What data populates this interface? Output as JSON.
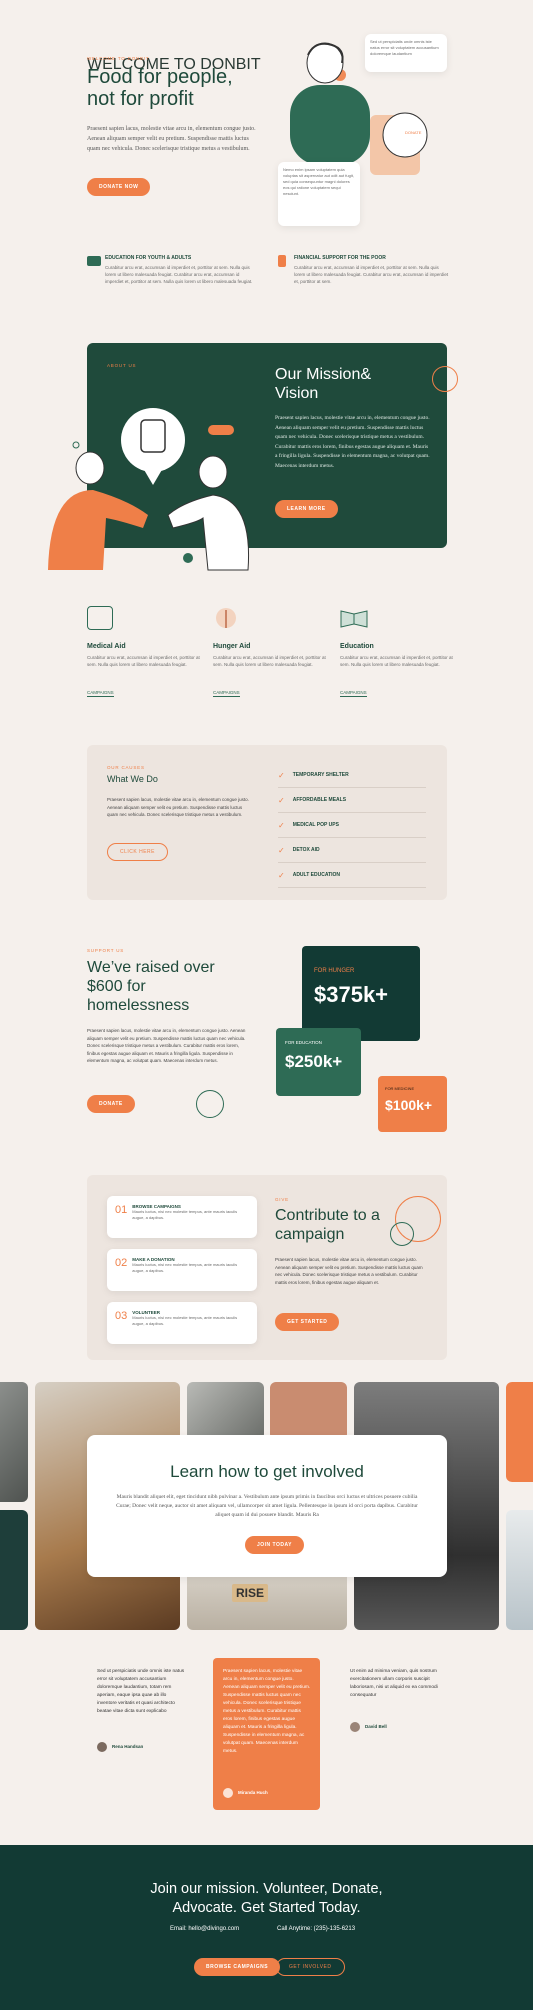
{
  "hero": {
    "eyebrow": "WELCOME TO DONBIT",
    "title": "Food for people, not for profit",
    "body": "Praesent sapien lacus, molestie vitae arcu in, elementum congue justo. Aenean aliquam semper velit eu pretium. Suspendisse mattis luctus quam nec vehicula. Donec scelerisque tristique metus a vestibulum.",
    "button": "DONATE NOW",
    "bubble1": "Sed ut perspiciatis unde omnis iste natus error sit voluptatem accusantium doloremque laudantium",
    "bubble2": "Nemo enim ipsam voluptatem quia voluptas sit aspernatur aut odit aut fugit, sed quia consequuntur magni dolores eos qui ratione voluptatem sequi nesciunt.",
    "donate_badge": "DONATE"
  },
  "features": [
    {
      "title": "EDUCATION FOR YOUTH & ADULTS",
      "body": "Curabitur arcu erat, accumsan id imperdiet et, porttitor at sem. Nulla quis lorem ut libero malesuada feugiat. Curabitur arcu erat, accumsan id imperdiet et, porttitor at sem. Nulla quis lorem ut libero malesuada feugiat."
    },
    {
      "title": "FINANCIAL SUPPORT FOR THE POOR",
      "body": "Curabitur arcu erat, accumsan id imperdiet et, porttitor at sem. Nulla quis lorem ut libero malesuada feugiat. Curabitur arcu erat, accumsan id imperdiet et, porttitor at sem."
    }
  ],
  "mission": {
    "eyebrow": "ABOUT US",
    "title": "Our Mission& Vision",
    "body": "Praesent sapien lacus, molestie vitae arcu in, elementum congue justo. Aenean aliquam semper velit eu pretium. Suspendisse mattis luctus quam nec vehicula. Donec scelerisque tristique metus a vestibulum. Curabitur mattis eros lorem, finibus egestas augue aliquam et. Mauris a fringilla ligula. Suspendisse in elementum magna, ac volutpat quam. Maecenas interdum metus.",
    "button": "LEARN MORE"
  },
  "programs": [
    {
      "title": "Medical Aid",
      "body": "Curabitur arcu erat, accumsan id imperdiet et, porttitor at sem. Nulla quis lorem ut libero malesuada feugiat.",
      "link": "CAMPAIGNS"
    },
    {
      "title": "Hunger Aid",
      "body": "Curabitur arcu erat, accumsan id imperdiet et, porttitor at sem. Nulla quis lorem ut libero malesuada feugiat.",
      "link": "CAMPAIGNS"
    },
    {
      "title": "Education",
      "body": "Curabitur arcu erat, accumsan id imperdiet et, porttitor at sem. Nulla quis lorem ut libero malesuada feugiat.",
      "link": "CAMPAIGNS"
    }
  ],
  "causes": {
    "eyebrow": "OUR CAUSES",
    "title": "What We Do",
    "body": "Praesent sapien lacus, molestie vitae arcu in, elementum congue justo. Aenean aliquam semper velit eu pretium. Suspendisse mattis luctus quam nec vehicula. Donec scelerisque tristique metus a vestibulum.",
    "button": "CLICK HERE",
    "items": [
      "TEMPORARY SHELTER",
      "AFFORDABLE MEALS",
      "MEDICAL POP UPS",
      "DETOX AID",
      "ADULT EDUCATION"
    ]
  },
  "raised": {
    "eyebrow": "SUPPORT US",
    "title": "We’ve raised over $600 for homelessness",
    "body": "Praesent sapien lacus, molestie vitae arcu in, elementum congue justo. Aenean aliquam semper velit eu pretium. Suspendisse mattis luctus quam nec vehicula. Donec scelerisque tristique metus a vestibulum. Curabitur mattis eros lorem, finibus egestas augue aliquam et. Mauris a fringilla ligula. Suspendisse in elementum magna, ac volutpat quam. Maecenas interdum metus.",
    "button": "DONATE",
    "stats": [
      {
        "label": "FOR HUNGER",
        "value": "$375k+"
      },
      {
        "label": "FOR EDUCATION",
        "value": "$250k+"
      },
      {
        "label": "FOR MEDICINE",
        "value": "$100k+"
      }
    ]
  },
  "contribute": {
    "eyebrow": "GIVE",
    "title": "Contribute to a campaign",
    "body": "Praesent sapien lacus, molestie vitae arcu in, elementum congue justo. Aenean aliquam semper velit eu pretium. Suspendisse mattis luctus quam nec vehicula. Donec scelerisque tristique metus a vestibulum. Curabitur mattis eros lorem, finibus egestas augue aliquam et.",
    "button": "GET STARTED",
    "steps": [
      {
        "num": "01",
        "title": "BROWSE CAMPAIGNS",
        "body": "Mauris luctus, nisi nec molestie tempus, ante mauris iaculis augue, a dapibus."
      },
      {
        "num": "02",
        "title": "MAKE A DONATION",
        "body": "Mauris luctus, nisi nec molestie tempus, ante mauris iaculis augue, a dapibus."
      },
      {
        "num": "03",
        "title": "VOLUNTEER",
        "body": "Mauris luctus, nisi nec molestie tempus, ante mauris iaculis augue, a dapibus."
      }
    ]
  },
  "involved": {
    "title": "Learn how to get involved",
    "body": "Mauris blandit aliquet elit, eget tincidunt nibh pulvinar a. Vestibulum ante ipsum primis in faucibus orci luctus et ultrices posuere cubilia Curae; Donec velit neque, auctor sit amet aliquam vel, ullamcorper sit amet ligula. Pellentesque in ipsum id orci porta dapibus. Curabitur aliquet quam id dui posuere blandit. Mauris Ra",
    "button": "JOIN TODAY",
    "tile_text": "RISE"
  },
  "testimonials": [
    {
      "quote": "Sed ut perspiciatis unde omnis iste natus error sit voluptatem accusantium doloremque laudantium, totam rem aperiam, eaque ipsa quae ab illo inventore veritatis et quasi architecto beatae vitae dicta sunt explicabo",
      "name": "Rena Handsan"
    },
    {
      "quote": "Praesent sapien lacus, molestie vitae arcu in, elementum congue justo. Aenean aliquam semper velit eu pretium. Suspendisse mattis luctus quam nec vehicula. Donec scelerisque tristique metus a vestibulum. Curabitur mattis eros lorem, finibus egestas augue aliquam et. Mauris a fringilla ligula. Suspendisse in elementum magna, ac volutpat quam. Maecenas interdum metus.",
      "name": "Miranda Huch"
    },
    {
      "quote": "Ut enim ad minima veniam, quis nostrum exercitationem ullam corporis suscipit laboriosam, nisi ut aliquid ex ea commodi consequatur",
      "name": "David Bell"
    }
  ],
  "cta": {
    "title": "Join our mission. Volunteer, Donate, Advocate. Get Started Today.",
    "email": "Email: hello@divingo.com",
    "phone": "Call Anytime: (235)-135-6213",
    "primary": "BROWSE CAMPAIGNS",
    "secondary": "GET INVOLVED"
  },
  "colors": {
    "accent": "#ef7f48",
    "dark_green": "#1f4a3b",
    "mid_green": "#2e6b55",
    "bg": "#f5f0ec",
    "footer": "#123a34"
  }
}
